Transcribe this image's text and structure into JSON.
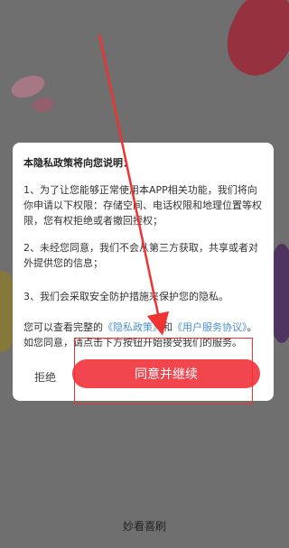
{
  "dialog": {
    "title": "本隐私政策将向您说明：",
    "p1": "1、为了让您能够正常使用本APP相关功能，我们将向你申请以下权限：存储空间、电话权限和地理位置等权限，您有权拒绝或者撤回授权；",
    "p2": "2、未经您同意，我们不会从第三方获取，共享或者对外提供您的信息；",
    "p3": "3、我们会采取安全防护措施来保护您的隐私。",
    "p4_prefix": "您可以查看完整的",
    "privacy_link": "《隐私政策》",
    "p4_and": "和",
    "terms_link": "《用户服务协议》",
    "p4_suffix": "。如您同意，请点击下方按钮开始接受我们的服务。",
    "refuse_label": "拒绝",
    "agree_label": "同意并继续"
  },
  "footer": {
    "app_name": "妙看喜刷"
  },
  "colors": {
    "accent": "#f2464f",
    "link": "#4a8fd8",
    "annotation": "#ee3333"
  }
}
